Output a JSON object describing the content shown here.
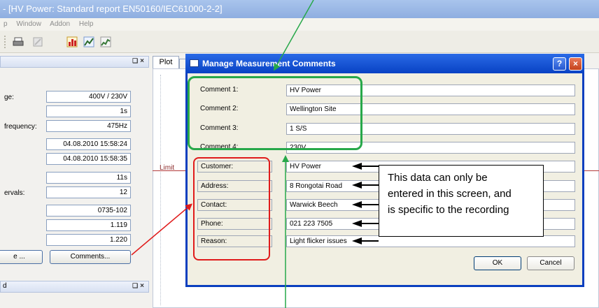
{
  "app": {
    "title": "- [HV Power: Standard report EN50160/IEC61000-2-2]",
    "menu": [
      "p",
      "Window",
      "Addon",
      "Help"
    ]
  },
  "left_panel": {
    "close": "×",
    "rows": [
      {
        "label": "ge:",
        "value": "400V / 230V"
      },
      {
        "label": "",
        "value": "1s"
      },
      {
        "label": "frequency:",
        "value": "475Hz"
      },
      {
        "label": "",
        "value": "04.08.2010 15:58:24"
      },
      {
        "label": "",
        "value": "04.08.2010 15:58:35"
      },
      {
        "label": "",
        "value": "11s"
      },
      {
        "label": "ervals:",
        "value": "12"
      },
      {
        "label": "",
        "value": "0735-102"
      },
      {
        "label": "",
        "value": "1.119"
      },
      {
        "label": "",
        "value": "1.220"
      }
    ],
    "button_left": "e ...",
    "button_comments": "Comments...",
    "panel2_title": "d"
  },
  "plot": {
    "tab": "Plot",
    "limit": "Limit"
  },
  "dialog": {
    "title": "Manage Measurement Comments",
    "help": "?",
    "close": "×",
    "comments": [
      {
        "label": "Comment 1:",
        "value": "HV Power"
      },
      {
        "label": "Comment 2:",
        "value": "Wellington Site"
      },
      {
        "label": "Comment 3:",
        "value": "1 S/S"
      },
      {
        "label": "Comment 4:",
        "value": "230V"
      }
    ],
    "fields": [
      {
        "label": "Customer:",
        "value": "HV Power"
      },
      {
        "label": "Address:",
        "value": "8 Rongotai Road"
      },
      {
        "label": "Contact:",
        "value": "Warwick Beech"
      },
      {
        "label": "Phone:",
        "value": "021 223 7505"
      },
      {
        "label": "Reason:",
        "value": "Light flicker issues"
      }
    ],
    "ok": "OK",
    "cancel": "Cancel"
  },
  "annotation": {
    "line1": "This data can only be",
    "line2": "entered in this screen, and",
    "line3": "is specific to the recording",
    "colors": {
      "green": "#27a84a",
      "red": "#e01b1b"
    }
  }
}
